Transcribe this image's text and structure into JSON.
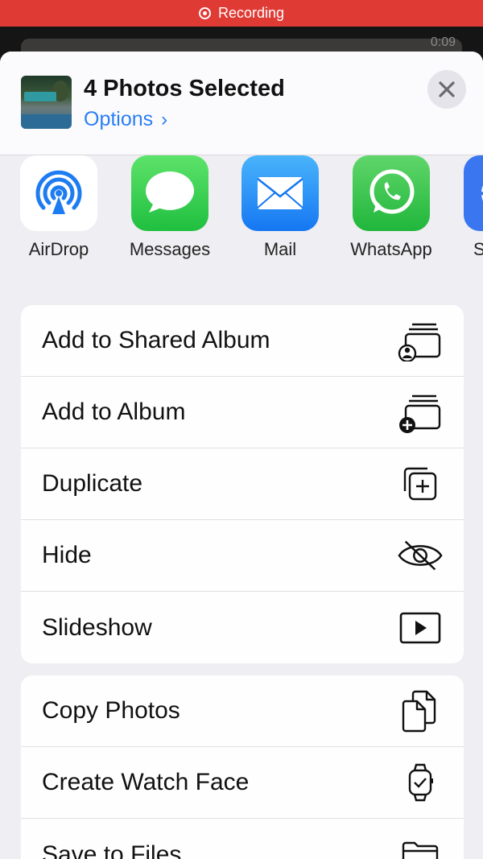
{
  "status_bar": {
    "recording_label": "Recording"
  },
  "background": {
    "video_duration": "0:09"
  },
  "sheet": {
    "title": "4 Photos Selected",
    "options_label": "Options",
    "options_chevron": "›",
    "close_glyph": "✕"
  },
  "apps": [
    {
      "label": "AirDrop",
      "icon": "airdrop-icon"
    },
    {
      "label": "Messages",
      "icon": "messages-icon"
    },
    {
      "label": "Mail",
      "icon": "mail-icon"
    },
    {
      "label": "WhatsApp",
      "icon": "whatsapp-icon"
    },
    {
      "label": "S",
      "icon": "signal-icon"
    }
  ],
  "actions_group_1": [
    {
      "label": "Add to Shared Album",
      "icon": "shared-album-icon"
    },
    {
      "label": "Add to Album",
      "icon": "add-album-icon"
    },
    {
      "label": "Duplicate",
      "icon": "duplicate-icon"
    },
    {
      "label": "Hide",
      "icon": "eye-slash-icon"
    },
    {
      "label": "Slideshow",
      "icon": "play-icon"
    }
  ],
  "actions_group_2": [
    {
      "label": "Copy Photos",
      "icon": "copy-icon"
    },
    {
      "label": "Create Watch Face",
      "icon": "watch-icon"
    },
    {
      "label": "Save to Files",
      "icon": "folder-icon"
    }
  ],
  "colors": {
    "recording_red": "#e03a35",
    "link_blue": "#2a7ef5",
    "sheet_background": "#efeef2"
  }
}
